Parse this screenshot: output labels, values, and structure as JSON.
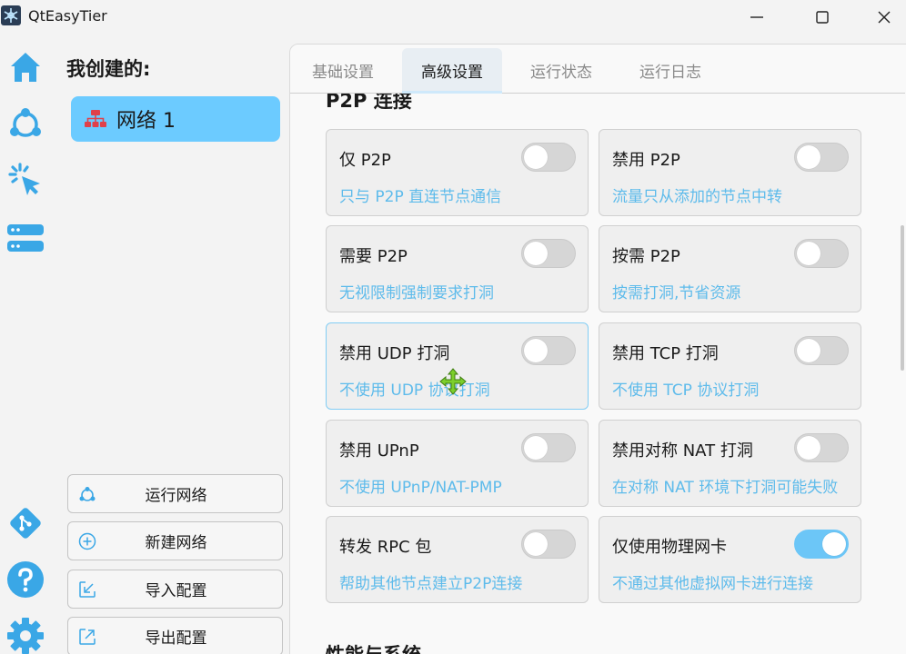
{
  "window": {
    "title": "QtEasyTier",
    "minimize_icon": "minimize-icon",
    "maximize_icon": "maximize-icon",
    "close_icon": "close-icon"
  },
  "nav": [
    {
      "icon": "home-icon"
    },
    {
      "icon": "network-icon"
    },
    {
      "icon": "click-icon"
    },
    {
      "icon": "server-icon"
    },
    {
      "icon": "git-icon"
    },
    {
      "icon": "help-icon"
    },
    {
      "icon": "settings-icon"
    }
  ],
  "network_panel": {
    "heading": "我创建的:",
    "items": [
      {
        "label": "网络 1",
        "icon": "sitemap-icon"
      }
    ],
    "actions": [
      {
        "label": "运行网络",
        "icon": "network-icon"
      },
      {
        "label": "新建网络",
        "icon": "plus-circle-icon"
      },
      {
        "label": "导入配置",
        "icon": "import-icon"
      },
      {
        "label": "导出配置",
        "icon": "export-icon"
      }
    ]
  },
  "tabs": [
    {
      "label": "基础设置",
      "active": false
    },
    {
      "label": "高级设置",
      "active": true
    },
    {
      "label": "运行状态",
      "active": false
    },
    {
      "label": "运行日志",
      "active": false
    }
  ],
  "sections": [
    {
      "title": "P2P 连接",
      "options": [
        {
          "title": "仅 P2P",
          "desc": "只与 P2P 直连节点通信",
          "on": false
        },
        {
          "title": "禁用 P2P",
          "desc": "流量只从添加的节点中转",
          "on": false
        },
        {
          "title": "需要 P2P",
          "desc": "无视限制强制要求打洞",
          "on": false
        },
        {
          "title": "按需 P2P",
          "desc": "按需打洞,节省资源",
          "on": false
        },
        {
          "title": "禁用 UDP 打洞",
          "desc": "不使用 UDP 协议打洞",
          "on": false
        },
        {
          "title": "禁用 TCP 打洞",
          "desc": "不使用 TCP 协议打洞",
          "on": false
        },
        {
          "title": "禁用 UPnP",
          "desc": "不使用 UPnP/NAT-PMP",
          "on": false
        },
        {
          "title": "禁用对称 NAT 打洞",
          "desc": "在对称 NAT 环境下打洞可能失败",
          "on": false
        },
        {
          "title": "转发 RPC 包",
          "desc": "帮助其他节点建立P2P连接",
          "on": false
        },
        {
          "title": "仅使用物理网卡",
          "desc": "不通过其他虚拟网卡进行连接",
          "on": true
        }
      ]
    },
    {
      "title": "性能与系统"
    }
  ],
  "colors": {
    "accent": "#6ccbff",
    "desc_text": "#5ebbeb",
    "toggle_on": "#6cc6f7",
    "net_item_icon": "#e0404a"
  }
}
